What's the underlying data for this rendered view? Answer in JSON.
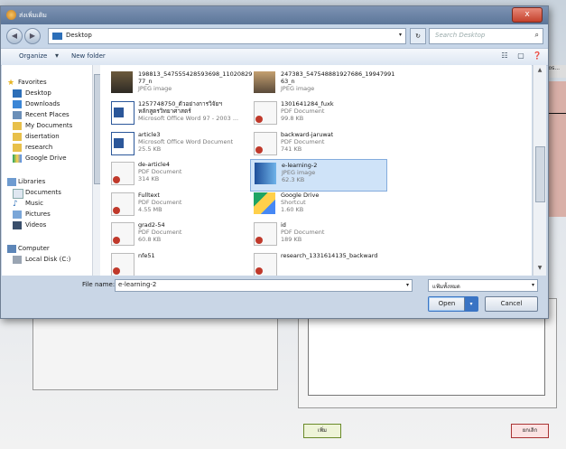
{
  "window": {
    "title": "ส่งเพิ่มเติม",
    "close_label": "x"
  },
  "nav": {
    "back_icon": "back-arrow-icon",
    "forward_icon": "forward-arrow-icon",
    "address": "Desktop",
    "search_placeholder": "Search Desktop"
  },
  "toolbar": {
    "organize": "Organize",
    "new_folder": "New folder"
  },
  "sidebar": {
    "favorites": "Favorites",
    "items_fav": [
      "Desktop",
      "Downloads",
      "Recent Places",
      "My Documents",
      "disertation",
      "research",
      "Google Drive"
    ],
    "libraries": "Libraries",
    "items_lib": [
      "Documents",
      "Music",
      "Pictures",
      "Videos"
    ],
    "computer": "Computer",
    "items_comp": [
      "Local Disk (C:)"
    ]
  },
  "files": [
    {
      "name": "198813_547555428593698_11020829\n77_n",
      "type": "JPEG image",
      "size": "",
      "icon": "photo",
      "col": 0,
      "row": 0
    },
    {
      "name": "247383_547548881927686_19947991\n63_n",
      "type": "JPEG image",
      "size": "",
      "icon": "photo2",
      "col": 1,
      "row": 0
    },
    {
      "name": "1257748750_ตัวอย่างการวิจัยฯ\nหลักสูตรวิทยาศาสตร์",
      "type": "Microsoft Office Word 97 - 2003 ...",
      "size": "",
      "icon": "word",
      "col": 0,
      "row": 1
    },
    {
      "name": "1301641284_fuxk",
      "type": "PDF Document",
      "size": "99.8 KB",
      "icon": "pdf",
      "col": 1,
      "row": 1
    },
    {
      "name": "article3",
      "type": "Microsoft Office Word Document",
      "size": "25.5 KB",
      "icon": "docx",
      "col": 0,
      "row": 2
    },
    {
      "name": "backward-jaruwat",
      "type": "PDF Document",
      "size": "741 KB",
      "icon": "pdf",
      "col": 1,
      "row": 2
    },
    {
      "name": "de-article4",
      "type": "PDF Document",
      "size": "314 KB",
      "icon": "pdf",
      "col": 0,
      "row": 3
    },
    {
      "name": "e-learning-2",
      "type": "JPEG image",
      "size": "62.3 KB",
      "icon": "elearn",
      "col": 1,
      "row": 3,
      "selected": true
    },
    {
      "name": "Fulltext",
      "type": "PDF Document",
      "size": "4.55 MB",
      "icon": "pdf",
      "col": 0,
      "row": 4
    },
    {
      "name": "Google Drive",
      "type": "Shortcut",
      "size": "1.60 KB",
      "icon": "gdrive",
      "col": 1,
      "row": 4
    },
    {
      "name": "grad2-54",
      "type": "PDF Document",
      "size": "60.8 KB",
      "icon": "pdf",
      "col": 0,
      "row": 5
    },
    {
      "name": "id",
      "type": "PDF Document",
      "size": "189 KB",
      "icon": "pdf",
      "col": 1,
      "row": 5
    },
    {
      "name": "nfe51",
      "type": "",
      "size": "",
      "icon": "pdf",
      "col": 0,
      "row": 6
    },
    {
      "name": "research_1331614135_backward",
      "type": "",
      "size": "",
      "icon": "pdf",
      "col": 1,
      "row": 6
    }
  ],
  "bottom": {
    "file_name_label": "File name:",
    "file_name_value": "e-learning-2",
    "file_type": "แฟ้มทั้งหมด",
    "open_label": "Open",
    "cancel_label": "Cancel"
  },
  "background": {
    "side_tab": "Hos...",
    "add_label": "เพิ่ม",
    "cancel_label": "ยกเลิก"
  },
  "colors": {
    "title_blue": "#5c7699",
    "selection": "#cfe3f8",
    "pdf_red": "#c0392b",
    "word_blue": "#2b579a"
  }
}
